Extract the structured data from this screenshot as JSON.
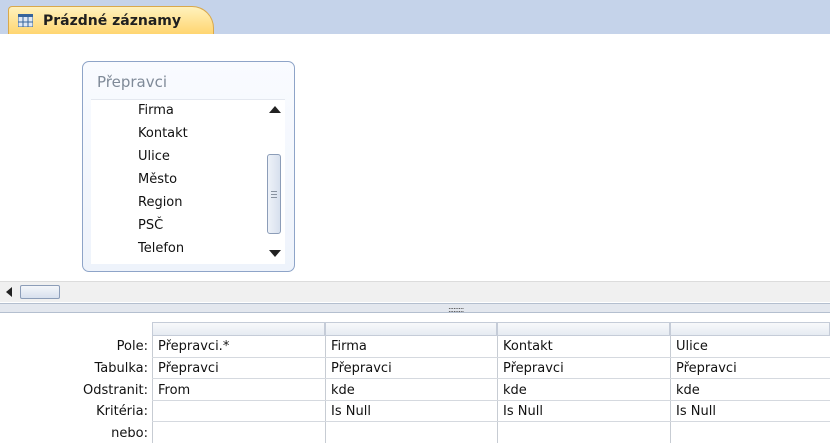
{
  "tab": {
    "label": "Prázdné záznamy",
    "icon": "query-icon"
  },
  "table_box": {
    "title": "Přepravci",
    "fields": [
      "Firma",
      "Kontakt",
      "Ulice",
      "Město",
      "Region",
      "PSČ",
      "Telefon"
    ]
  },
  "grid": {
    "row_labels": [
      "Pole:",
      "Tabulka:",
      "Odstranit:",
      "Kritéria:",
      "nebo:"
    ],
    "columns": [
      {
        "pole": "Přepravci.*",
        "tabulka": "Přepravci",
        "odstranit": "From",
        "kriteria": ""
      },
      {
        "pole": "Firma",
        "tabulka": "Přepravci",
        "odstranit": "kde",
        "kriteria": "Is Null"
      },
      {
        "pole": "Kontakt",
        "tabulka": "Přepravci",
        "odstranit": "kde",
        "kriteria": "Is Null"
      },
      {
        "pole": "Ulice",
        "tabulka": "Přepravci",
        "odstranit": "kde",
        "kriteria": "Is Null"
      }
    ]
  }
}
